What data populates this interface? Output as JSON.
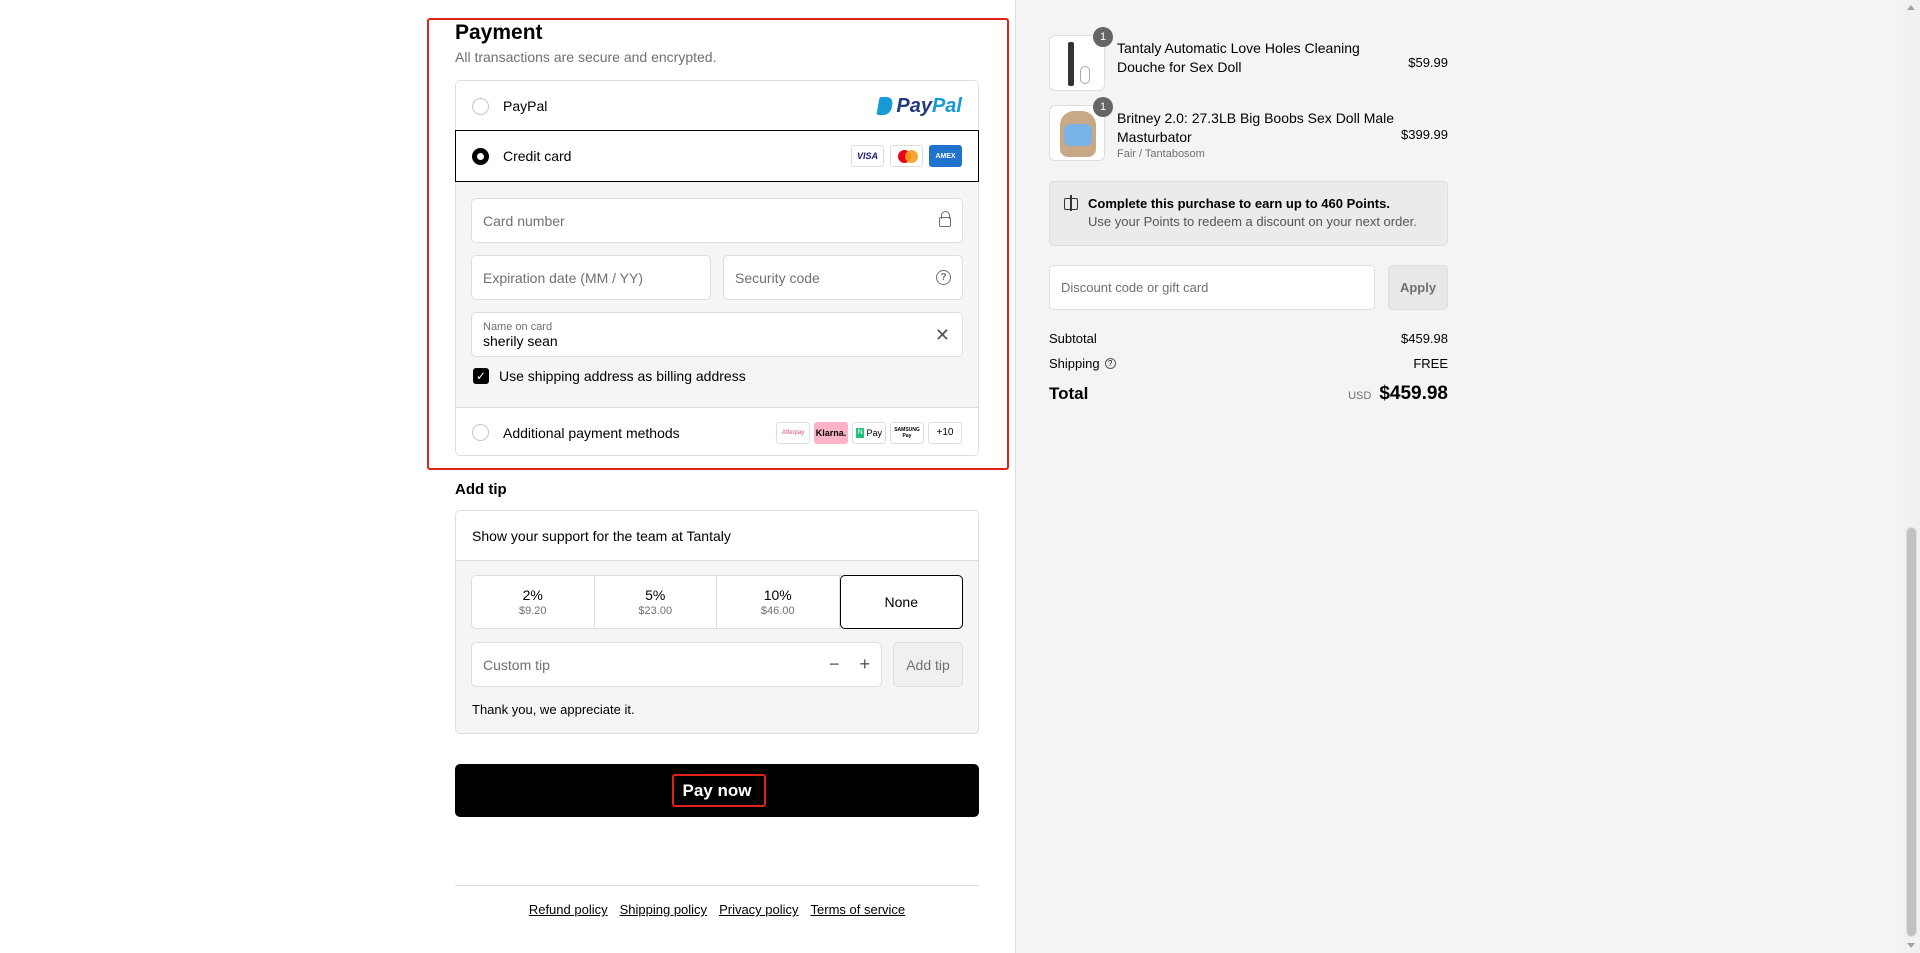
{
  "payment": {
    "title": "Payment",
    "subtitle": "All transactions are secure and encrypted.",
    "options": {
      "paypal": {
        "label": "PayPal",
        "logo_left": "Pay",
        "logo_right": "Pal"
      },
      "credit_card": {
        "label": "Credit card",
        "card_logos": [
          "VISA",
          "Mastercard",
          "AMEX"
        ]
      },
      "additional": {
        "label": "Additional payment methods",
        "methods": [
          "Afterpay",
          "Klarna.",
          "Pay",
          "SAMSUNG Pay",
          "+10"
        ]
      }
    },
    "fields": {
      "card_number_placeholder": "Card number",
      "expiration_placeholder": "Expiration date (MM / YY)",
      "security_placeholder": "Security code",
      "name_label": "Name on card",
      "name_value": "sherily sean"
    },
    "billing_checkbox_label": "Use shipping address as billing address",
    "billing_checked": true
  },
  "tip": {
    "title": "Add tip",
    "support_text": "Show your support for the team at Tantaly",
    "options": [
      {
        "pct": "2%",
        "amount": "$9.20"
      },
      {
        "pct": "5%",
        "amount": "$23.00"
      },
      {
        "pct": "10%",
        "amount": "$46.00"
      }
    ],
    "none_label": "None",
    "custom_placeholder": "Custom tip",
    "add_button": "Add tip",
    "thanks": "Thank you, we appreciate it."
  },
  "pay_now_label": "Pay now",
  "footer_links": [
    "Refund policy",
    "Shipping policy",
    "Privacy policy",
    "Terms of service"
  ],
  "summary": {
    "items": [
      {
        "qty": "1",
        "name": "Tantaly Automatic Love Holes Cleaning Douche for Sex Doll",
        "variant": "",
        "price": "$59.99"
      },
      {
        "qty": "1",
        "name": "Britney 2.0: 27.3LB Big Boobs Sex Doll Male Masturbator",
        "variant": "Fair / Tantabosom",
        "price": "$399.99"
      }
    ],
    "points_title": "Complete this purchase to earn up to 460 Points.",
    "points_sub": "Use your Points to redeem a discount on your next order.",
    "discount_placeholder": "Discount code or gift card",
    "apply_label": "Apply",
    "subtotal_label": "Subtotal",
    "subtotal_value": "$459.98",
    "shipping_label": "Shipping",
    "shipping_value": "FREE",
    "total_label": "Total",
    "currency": "USD",
    "total_value": "$459.98"
  }
}
